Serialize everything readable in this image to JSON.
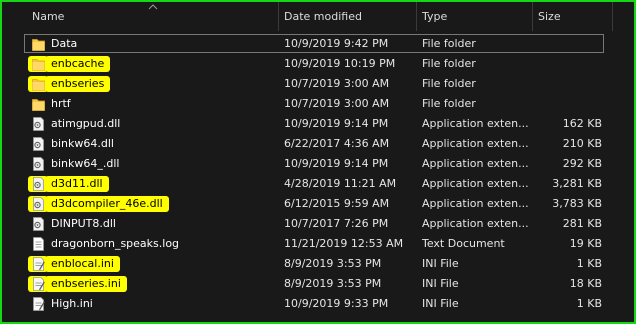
{
  "columns": {
    "name": "Name",
    "date": "Date modified",
    "type": "Type",
    "size": "Size"
  },
  "colors": {
    "accent_border": "#16d616",
    "highlight": "#ffff00",
    "background": "#191919"
  },
  "rows": [
    {
      "name": "Data",
      "date": "10/9/2019 9:42 PM",
      "type": "File folder",
      "size": "",
      "icon": "folder-icon",
      "highlighted": false,
      "selected": true
    },
    {
      "name": "enbcache",
      "date": "10/9/2019 10:19 PM",
      "type": "File folder",
      "size": "",
      "icon": "folder-icon",
      "highlighted": true
    },
    {
      "name": "enbseries",
      "date": "10/7/2019 3:00 AM",
      "type": "File folder",
      "size": "",
      "icon": "folder-icon",
      "highlighted": true
    },
    {
      "name": "hrtf",
      "date": "10/7/2019 3:00 AM",
      "type": "File folder",
      "size": "",
      "icon": "folder-icon",
      "highlighted": false
    },
    {
      "name": "atimgpud.dll",
      "date": "10/9/2019 9:14 PM",
      "type": "Application exten...",
      "size": "162 KB",
      "icon": "dll-icon",
      "highlighted": false
    },
    {
      "name": "binkw64.dll",
      "date": "6/22/2017 4:36 AM",
      "type": "Application exten...",
      "size": "210 KB",
      "icon": "dll-icon",
      "highlighted": false
    },
    {
      "name": "binkw64_.dll",
      "date": "10/9/2019 9:14 PM",
      "type": "Application exten...",
      "size": "292 KB",
      "icon": "dll-icon",
      "highlighted": false
    },
    {
      "name": "d3d11.dll",
      "date": "4/28/2019 11:21 AM",
      "type": "Application exten...",
      "size": "3,281 KB",
      "icon": "dll-icon",
      "highlighted": true
    },
    {
      "name": "d3dcompiler_46e.dll",
      "date": "6/12/2015 9:59 AM",
      "type": "Application exten...",
      "size": "3,783 KB",
      "icon": "dll-icon",
      "highlighted": true
    },
    {
      "name": "DINPUT8.dll",
      "date": "10/7/2017 7:26 PM",
      "type": "Application exten...",
      "size": "281 KB",
      "icon": "dll-icon",
      "highlighted": false
    },
    {
      "name": "dragonborn_speaks.log",
      "date": "11/21/2019 12:53 AM",
      "type": "Text Document",
      "size": "19 KB",
      "icon": "text-file-icon",
      "highlighted": false
    },
    {
      "name": "enblocal.ini",
      "date": "8/9/2019 3:53 PM",
      "type": "INI File",
      "size": "1 KB",
      "icon": "ini-file-icon",
      "highlighted": true
    },
    {
      "name": "enbseries.ini",
      "date": "8/9/2019 3:53 PM",
      "type": "INI File",
      "size": "18 KB",
      "icon": "ini-file-icon",
      "highlighted": true
    },
    {
      "name": "High.ini",
      "date": "10/9/2019 9:33 PM",
      "type": "INI File",
      "size": "1 KB",
      "icon": "ini-file-icon",
      "highlighted": false
    }
  ]
}
